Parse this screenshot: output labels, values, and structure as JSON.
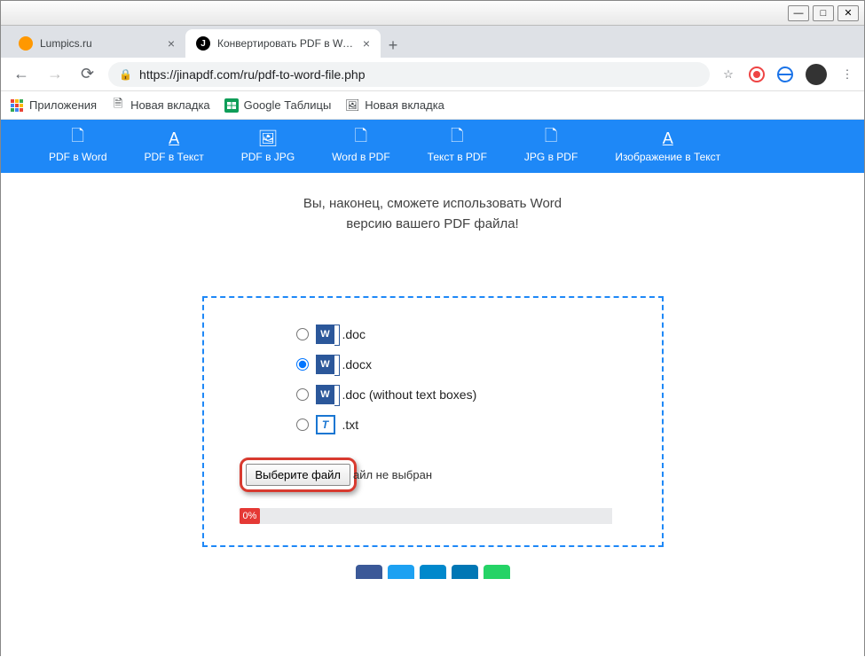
{
  "window": {
    "minimize": "—",
    "maximize": "□",
    "close": "✕"
  },
  "tabs": [
    {
      "title": "Lumpics.ru",
      "favicon": "#ff9800"
    },
    {
      "title": "Конвертировать PDF в Word - P",
      "favicon": "#000"
    }
  ],
  "newtab": "+",
  "nav": {
    "back": "←",
    "forward": "→",
    "reload": "⟳"
  },
  "url": {
    "lock": "🔒",
    "text": "https://jinapdf.com/ru/pdf-to-word-file.php",
    "star": "☆",
    "menu": "⋮"
  },
  "bookmarks": [
    {
      "icon": "apps",
      "label": "Приложения"
    },
    {
      "icon": "page",
      "label": "Новая вкладка"
    },
    {
      "icon": "sheets",
      "label": "Google Таблицы"
    },
    {
      "icon": "img",
      "label": "Новая вкладка"
    }
  ],
  "menuitems": [
    {
      "label": "PDF в Word"
    },
    {
      "label": "PDF в Текст"
    },
    {
      "label": "PDF в JPG"
    },
    {
      "label": "Word в PDF"
    },
    {
      "label": "Текст в PDF"
    },
    {
      "label": "JPG в PDF"
    },
    {
      "label": "Изображение в Текст"
    }
  ],
  "subtitle1": "Вы, наконец, сможете использовать Word",
  "subtitle2": "версию вашего PDF файла!",
  "formats": [
    {
      "label": ".doc",
      "icon": "w",
      "checked": false
    },
    {
      "label": ".docx",
      "icon": "w",
      "checked": true
    },
    {
      "label": ".doc (without text boxes)",
      "icon": "w",
      "checked": false
    },
    {
      "label": ".txt",
      "icon": "t",
      "checked": false
    }
  ],
  "filebtn": "Выберите файл",
  "filestatus": "айл не выбран",
  "progress": "0%",
  "social_colors": [
    "#3b5998",
    "#1da1f2",
    "#0088cc",
    "#0077b5",
    "#25d366"
  ]
}
